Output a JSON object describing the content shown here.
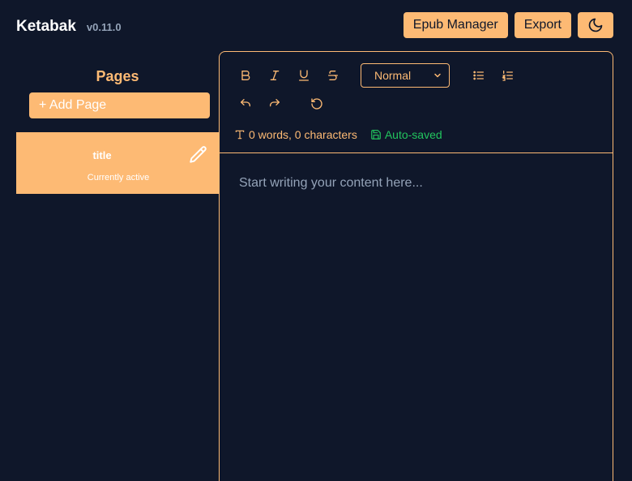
{
  "app": {
    "name": "Ketabak",
    "version": "v0.11.0"
  },
  "header": {
    "epub_manager_label": "Epub Manager",
    "export_label": "Export",
    "theme_icon": "moon-icon"
  },
  "sidebar": {
    "heading": "Pages",
    "add_page_label": "+ Add Page",
    "pages": [
      {
        "title": "title",
        "status": "Currently active"
      }
    ]
  },
  "editor": {
    "toolbar": {
      "tools": [
        "bold-icon",
        "italic-icon",
        "underline-icon",
        "strikethrough-icon",
        "bullet-list-icon",
        "numbered-list-icon",
        "undo-icon",
        "redo-icon",
        "history-icon"
      ],
      "format_value": "Normal"
    },
    "stats": {
      "words": "0 words, 0 characters",
      "saved": "Auto-saved"
    },
    "placeholder": "Start writing your content here..."
  },
  "colors": {
    "background": "#0f172a",
    "accent": "#fdba74",
    "muted": "#94a3b8",
    "success": "#22c55e"
  }
}
